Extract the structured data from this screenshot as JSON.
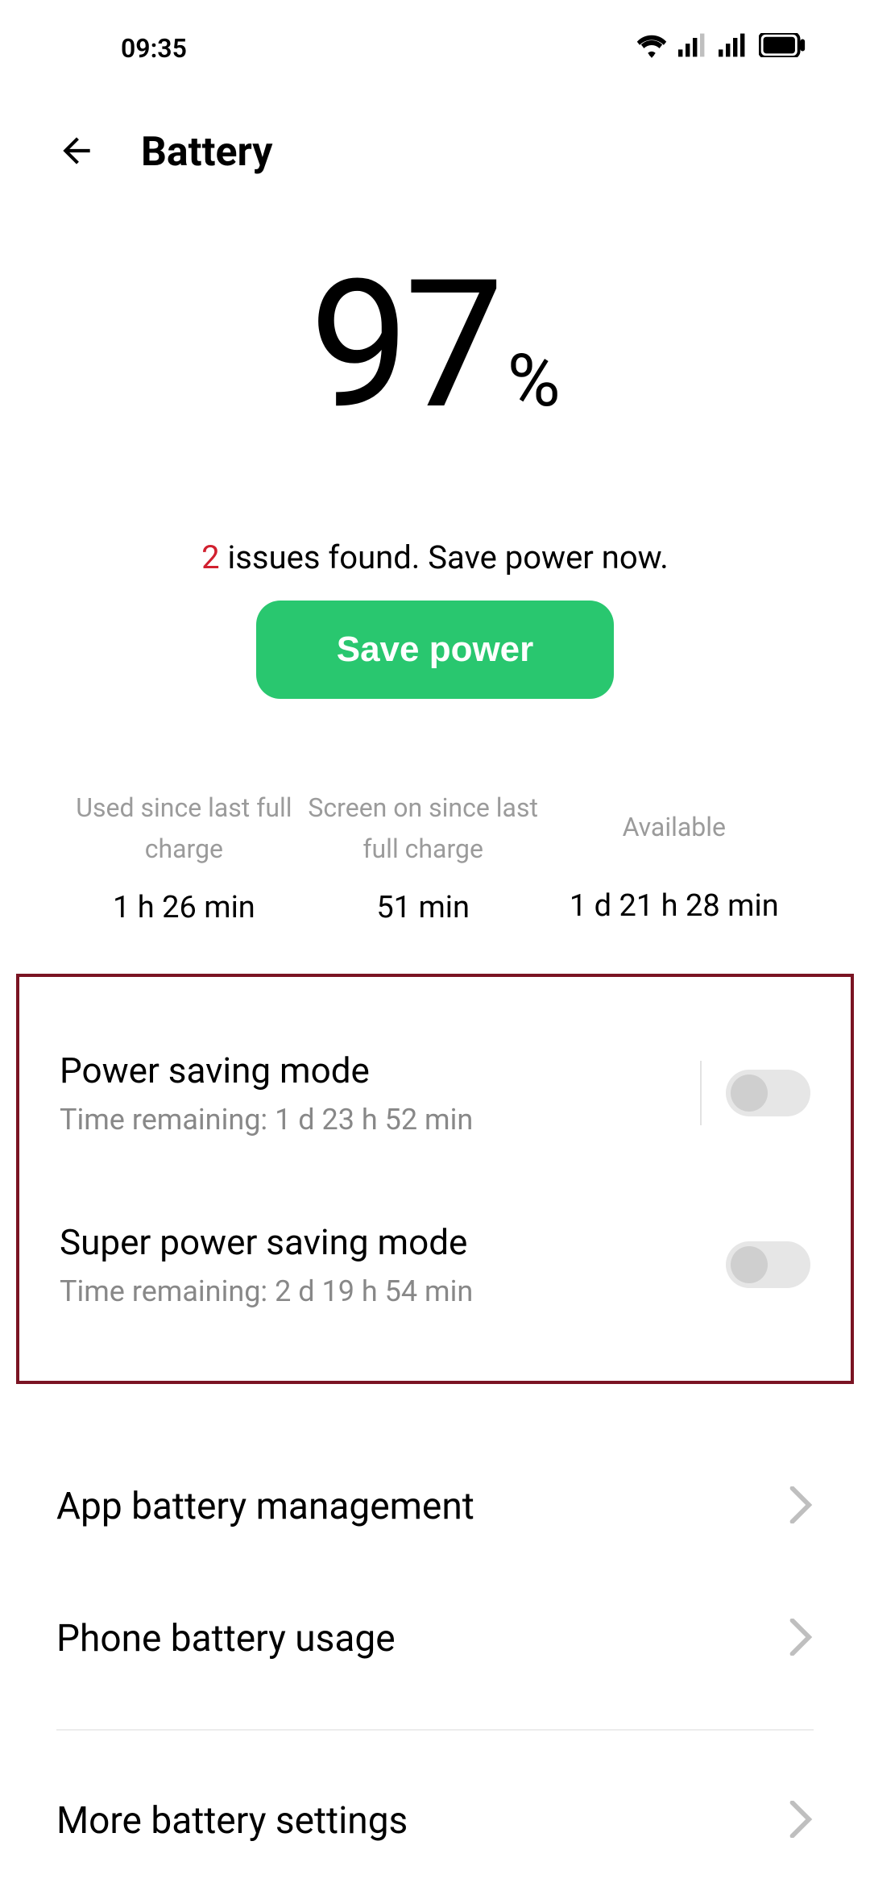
{
  "status_bar": {
    "time": "09:35"
  },
  "header": {
    "title": "Battery"
  },
  "battery": {
    "percent": "97",
    "percent_symbol": "%",
    "issues_count": "2",
    "issues_text": " issues found. Save power now.",
    "save_button": "Save power"
  },
  "stats": {
    "used_label": "Used since last full charge",
    "used_value": "1 h 26 min",
    "screen_label": "Screen on since last full charge",
    "screen_value": "51 min",
    "avail_label": "Available",
    "avail_value": "1 d 21 h 28 min"
  },
  "modes": {
    "power_saving": {
      "title": "Power saving mode",
      "sub": "Time remaining:  1 d 23 h 52 min",
      "on": false
    },
    "super_saving": {
      "title": "Super power saving mode",
      "sub": "Time remaining:  2 d 19 h 54 min",
      "on": false
    }
  },
  "list": {
    "app_mgmt": "App battery management",
    "phone_usage": "Phone battery usage",
    "more_settings": "More battery settings"
  }
}
